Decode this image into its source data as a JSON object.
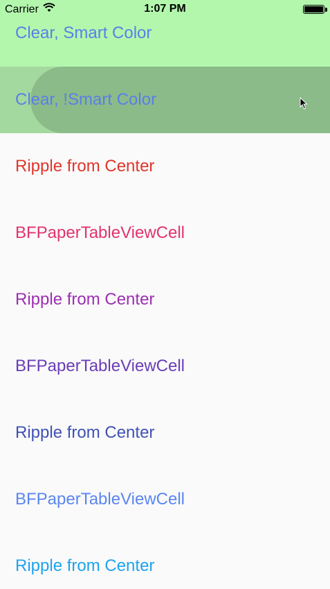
{
  "status_bar": {
    "carrier": "Carrier",
    "time": "1:07 PM",
    "battery_level": 1.0
  },
  "cells": [
    {
      "label": "Clear, Smart Color",
      "text_color": "#5a7fe6",
      "background": "#b3f7ad"
    },
    {
      "label": "Clear, !Smart Color",
      "text_color": "#5a7fe6",
      "background": "#a3d99e",
      "ripple_color": "#8cbb8a"
    },
    {
      "label": "Ripple from Center",
      "text_color": "#e0352b",
      "background": "#fafafa"
    },
    {
      "label": "BFPaperTableViewCell",
      "text_color": "#e2336f",
      "background": "#fafafa"
    },
    {
      "label": "Ripple from Center",
      "text_color": "#9c2fb2",
      "background": "#fafafa"
    },
    {
      "label": "BFPaperTableViewCell",
      "text_color": "#6a3db7",
      "background": "#fafafa"
    },
    {
      "label": "Ripple from Center",
      "text_color": "#3f51b5",
      "background": "#fafafa"
    },
    {
      "label": "BFPaperTableViewCell",
      "text_color": "#5b86f0",
      "background": "#fafafa"
    },
    {
      "label": "Ripple from Center",
      "text_color": "#1fa3ee",
      "background": "#fafafa"
    }
  ],
  "icons": [
    "wifi-icon",
    "battery-icon",
    "mouse-cursor-icon"
  ]
}
